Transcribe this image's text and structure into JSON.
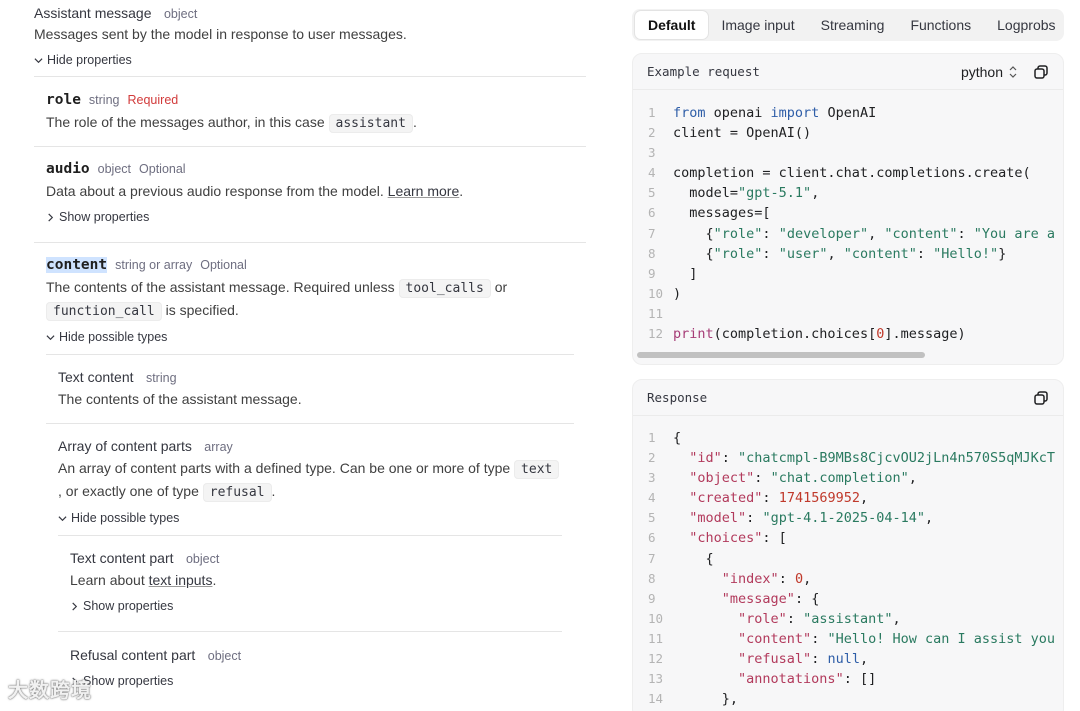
{
  "left": {
    "assistant_title": "Assistant message",
    "assistant_type": "object",
    "assistant_desc": "Messages sent by the model in response to user messages.",
    "hide_properties": "Hide properties",
    "role": {
      "name": "role",
      "type": "string",
      "required": "Required",
      "desc_pre": "The role of the messages author, in this case",
      "desc_code": "assistant",
      "desc_post": "."
    },
    "audio": {
      "name": "audio",
      "type": "object",
      "optional": "Optional",
      "desc_pre": "Data about a previous audio response from the model.",
      "desc_link": "Learn more",
      "desc_post": ".",
      "show_properties": "Show properties"
    },
    "content": {
      "name": "content",
      "type": "string or array",
      "optional": "Optional",
      "desc_pre": "The contents of the assistant message. Required unless",
      "code1": "tool_calls",
      "or": "or",
      "code2": "function_call",
      "desc_post": "is specified.",
      "hide_types": "Hide possible types"
    },
    "text_content": {
      "title": "Text content",
      "type": "string",
      "desc": "The contents of the assistant message."
    },
    "array_parts": {
      "title": "Array of content parts",
      "type": "array",
      "desc_pre": "An array of content parts with a defined type. Can be one or more of type",
      "code1": "text",
      "desc_mid": ", or exactly one of type",
      "code2": "refusal",
      "desc_post": ".",
      "hide_types": "Hide possible types"
    },
    "text_part": {
      "title": "Text content part",
      "type": "object",
      "desc_pre": "Learn about",
      "desc_link": "text inputs",
      "desc_post": ".",
      "show_properties": "Show properties"
    },
    "refusal_part": {
      "title": "Refusal content part",
      "type": "object",
      "show_properties": "Show properties"
    }
  },
  "tabs": [
    "Default",
    "Image input",
    "Streaming",
    "Functions",
    "Logprobs"
  ],
  "request": {
    "title": "Example request",
    "language": "python",
    "lines": [
      [
        [
          "kw",
          "from"
        ],
        [
          "plain",
          " openai "
        ],
        [
          "kw",
          "import"
        ],
        [
          "plain",
          " OpenAI"
        ]
      ],
      [
        [
          "plain",
          "client = OpenAI()"
        ]
      ],
      [],
      [
        [
          "plain",
          "completion = client.chat.completions.create("
        ]
      ],
      [
        [
          "plain",
          "  model="
        ],
        [
          "str",
          "\"gpt-5.1\""
        ],
        [
          "plain",
          ","
        ]
      ],
      [
        [
          "plain",
          "  messages=["
        ]
      ],
      [
        [
          "plain",
          "    {"
        ],
        [
          "str",
          "\"role\""
        ],
        [
          "plain",
          ": "
        ],
        [
          "str",
          "\"developer\""
        ],
        [
          "plain",
          ", "
        ],
        [
          "str",
          "\"content\""
        ],
        [
          "plain",
          ": "
        ],
        [
          "str",
          "\"You are a"
        ]
      ],
      [
        [
          "plain",
          "    {"
        ],
        [
          "str",
          "\"role\""
        ],
        [
          "plain",
          ": "
        ],
        [
          "str",
          "\"user\""
        ],
        [
          "plain",
          ", "
        ],
        [
          "str",
          "\"content\""
        ],
        [
          "plain",
          ": "
        ],
        [
          "str",
          "\"Hello!\""
        ],
        [
          "plain",
          "}"
        ]
      ],
      [
        [
          "plain",
          "  ]"
        ]
      ],
      [
        [
          "plain",
          ")"
        ]
      ],
      [],
      [
        [
          "fn",
          "print"
        ],
        [
          "plain",
          "(completion.choices["
        ],
        [
          "num",
          "0"
        ],
        [
          "plain",
          "].message)"
        ]
      ]
    ]
  },
  "response": {
    "title": "Response",
    "lines": [
      [
        [
          "plain",
          "{"
        ]
      ],
      [
        [
          "plain",
          "  "
        ],
        [
          "key",
          "\"id\""
        ],
        [
          "plain",
          ": "
        ],
        [
          "str",
          "\"chatcmpl-B9MBs8CjcvOU2jLn4n570S5qMJKcT"
        ]
      ],
      [
        [
          "plain",
          "  "
        ],
        [
          "key",
          "\"object\""
        ],
        [
          "plain",
          ": "
        ],
        [
          "str",
          "\"chat.completion\""
        ],
        [
          "plain",
          ","
        ]
      ],
      [
        [
          "plain",
          "  "
        ],
        [
          "key",
          "\"created\""
        ],
        [
          "plain",
          ": "
        ],
        [
          "num",
          "1741569952"
        ],
        [
          "plain",
          ","
        ]
      ],
      [
        [
          "plain",
          "  "
        ],
        [
          "key",
          "\"model\""
        ],
        [
          "plain",
          ": "
        ],
        [
          "str",
          "\"gpt-4.1-2025-04-14\""
        ],
        [
          "plain",
          ","
        ]
      ],
      [
        [
          "plain",
          "  "
        ],
        [
          "key",
          "\"choices\""
        ],
        [
          "plain",
          ": ["
        ]
      ],
      [
        [
          "plain",
          "    {"
        ]
      ],
      [
        [
          "plain",
          "      "
        ],
        [
          "key",
          "\"index\""
        ],
        [
          "plain",
          ": "
        ],
        [
          "num",
          "0"
        ],
        [
          "plain",
          ","
        ]
      ],
      [
        [
          "plain",
          "      "
        ],
        [
          "key",
          "\"message\""
        ],
        [
          "plain",
          ": {"
        ]
      ],
      [
        [
          "plain",
          "        "
        ],
        [
          "key",
          "\"role\""
        ],
        [
          "plain",
          ": "
        ],
        [
          "str",
          "\"assistant\""
        ],
        [
          "plain",
          ","
        ]
      ],
      [
        [
          "plain",
          "        "
        ],
        [
          "key",
          "\"content\""
        ],
        [
          "plain",
          ": "
        ],
        [
          "str",
          "\"Hello! How can I assist you"
        ]
      ],
      [
        [
          "plain",
          "        "
        ],
        [
          "key",
          "\"refusal\""
        ],
        [
          "plain",
          ": "
        ],
        [
          "kw",
          "null"
        ],
        [
          "plain",
          ","
        ]
      ],
      [
        [
          "plain",
          "        "
        ],
        [
          "key",
          "\"annotations\""
        ],
        [
          "plain",
          ": []"
        ]
      ],
      [
        [
          "plain",
          "      },"
        ]
      ]
    ]
  },
  "watermark": "大数跨境"
}
